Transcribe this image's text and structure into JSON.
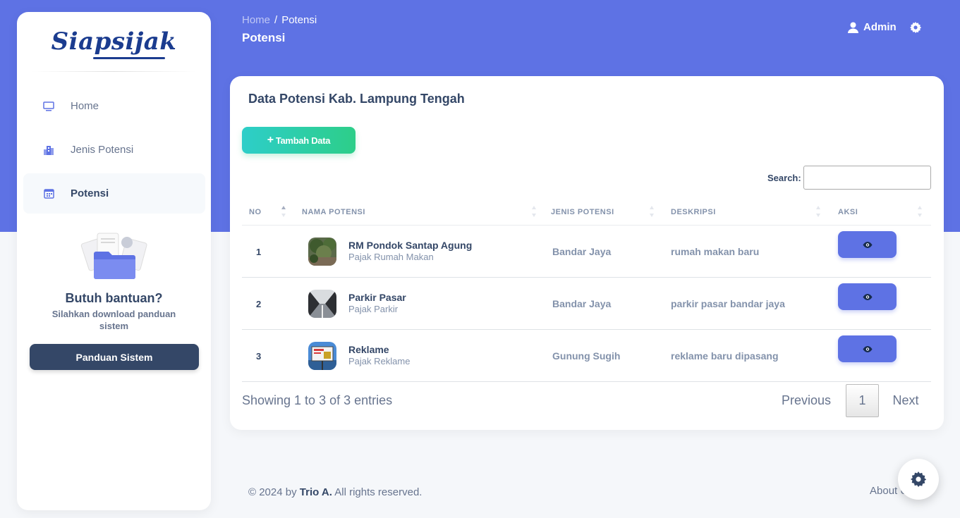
{
  "app": {
    "brand": "Siapsijak"
  },
  "sidebar": {
    "items": [
      {
        "label": "Home",
        "icon": "monitor-icon",
        "active": false
      },
      {
        "label": "Jenis Potensi",
        "icon": "building-icon",
        "active": false
      },
      {
        "label": "Potensi",
        "icon": "calendar-icon",
        "active": true
      }
    ],
    "help": {
      "title": "Butuh bantuan?",
      "text": "Silahkan download panduan sistem",
      "button_label": "Panduan Sistem"
    }
  },
  "header": {
    "breadcrumb": {
      "home": "Home",
      "separator": "/",
      "current": "Potensi"
    },
    "title": "Potensi",
    "user_label": "Admin"
  },
  "card": {
    "title": "Data Potensi Kab. Lampung Tengah",
    "add_button_label": "Tambah Data",
    "search_label": "Search:",
    "search_value": "",
    "columns": [
      "NO",
      "NAMA POTENSI",
      "JENIS POTENSI",
      "DESKRIPSI",
      "AKSI"
    ],
    "rows": [
      {
        "no": "1",
        "name": "RM Pondok Santap Agung",
        "sub": "Pajak Rumah Makan",
        "jenis": "Bandar Jaya",
        "deskripsi": "rumah makan baru"
      },
      {
        "no": "2",
        "name": "Parkir Pasar",
        "sub": "Pajak Parkir",
        "jenis": "Bandar Jaya",
        "deskripsi": "parkir pasar bandar jaya"
      },
      {
        "no": "3",
        "name": "Reklame",
        "sub": "Pajak Reklame",
        "jenis": "Gunung Sugih",
        "deskripsi": "reklame baru dipasang"
      }
    ],
    "info": "Showing 1 to 3 of 3 entries",
    "pagination": {
      "previous": "Previous",
      "current": "1",
      "next": "Next"
    }
  },
  "footer": {
    "copy_prefix": "© 2024 by",
    "author": "Trio A.",
    "copy_suffix": "All rights reserved.",
    "about": "About Us"
  },
  "colors": {
    "primary": "#5e72e4",
    "success_gradient_start": "#2dcec9",
    "success_gradient_end": "#2dce89",
    "dark": "#344767",
    "muted": "#8392ab"
  }
}
